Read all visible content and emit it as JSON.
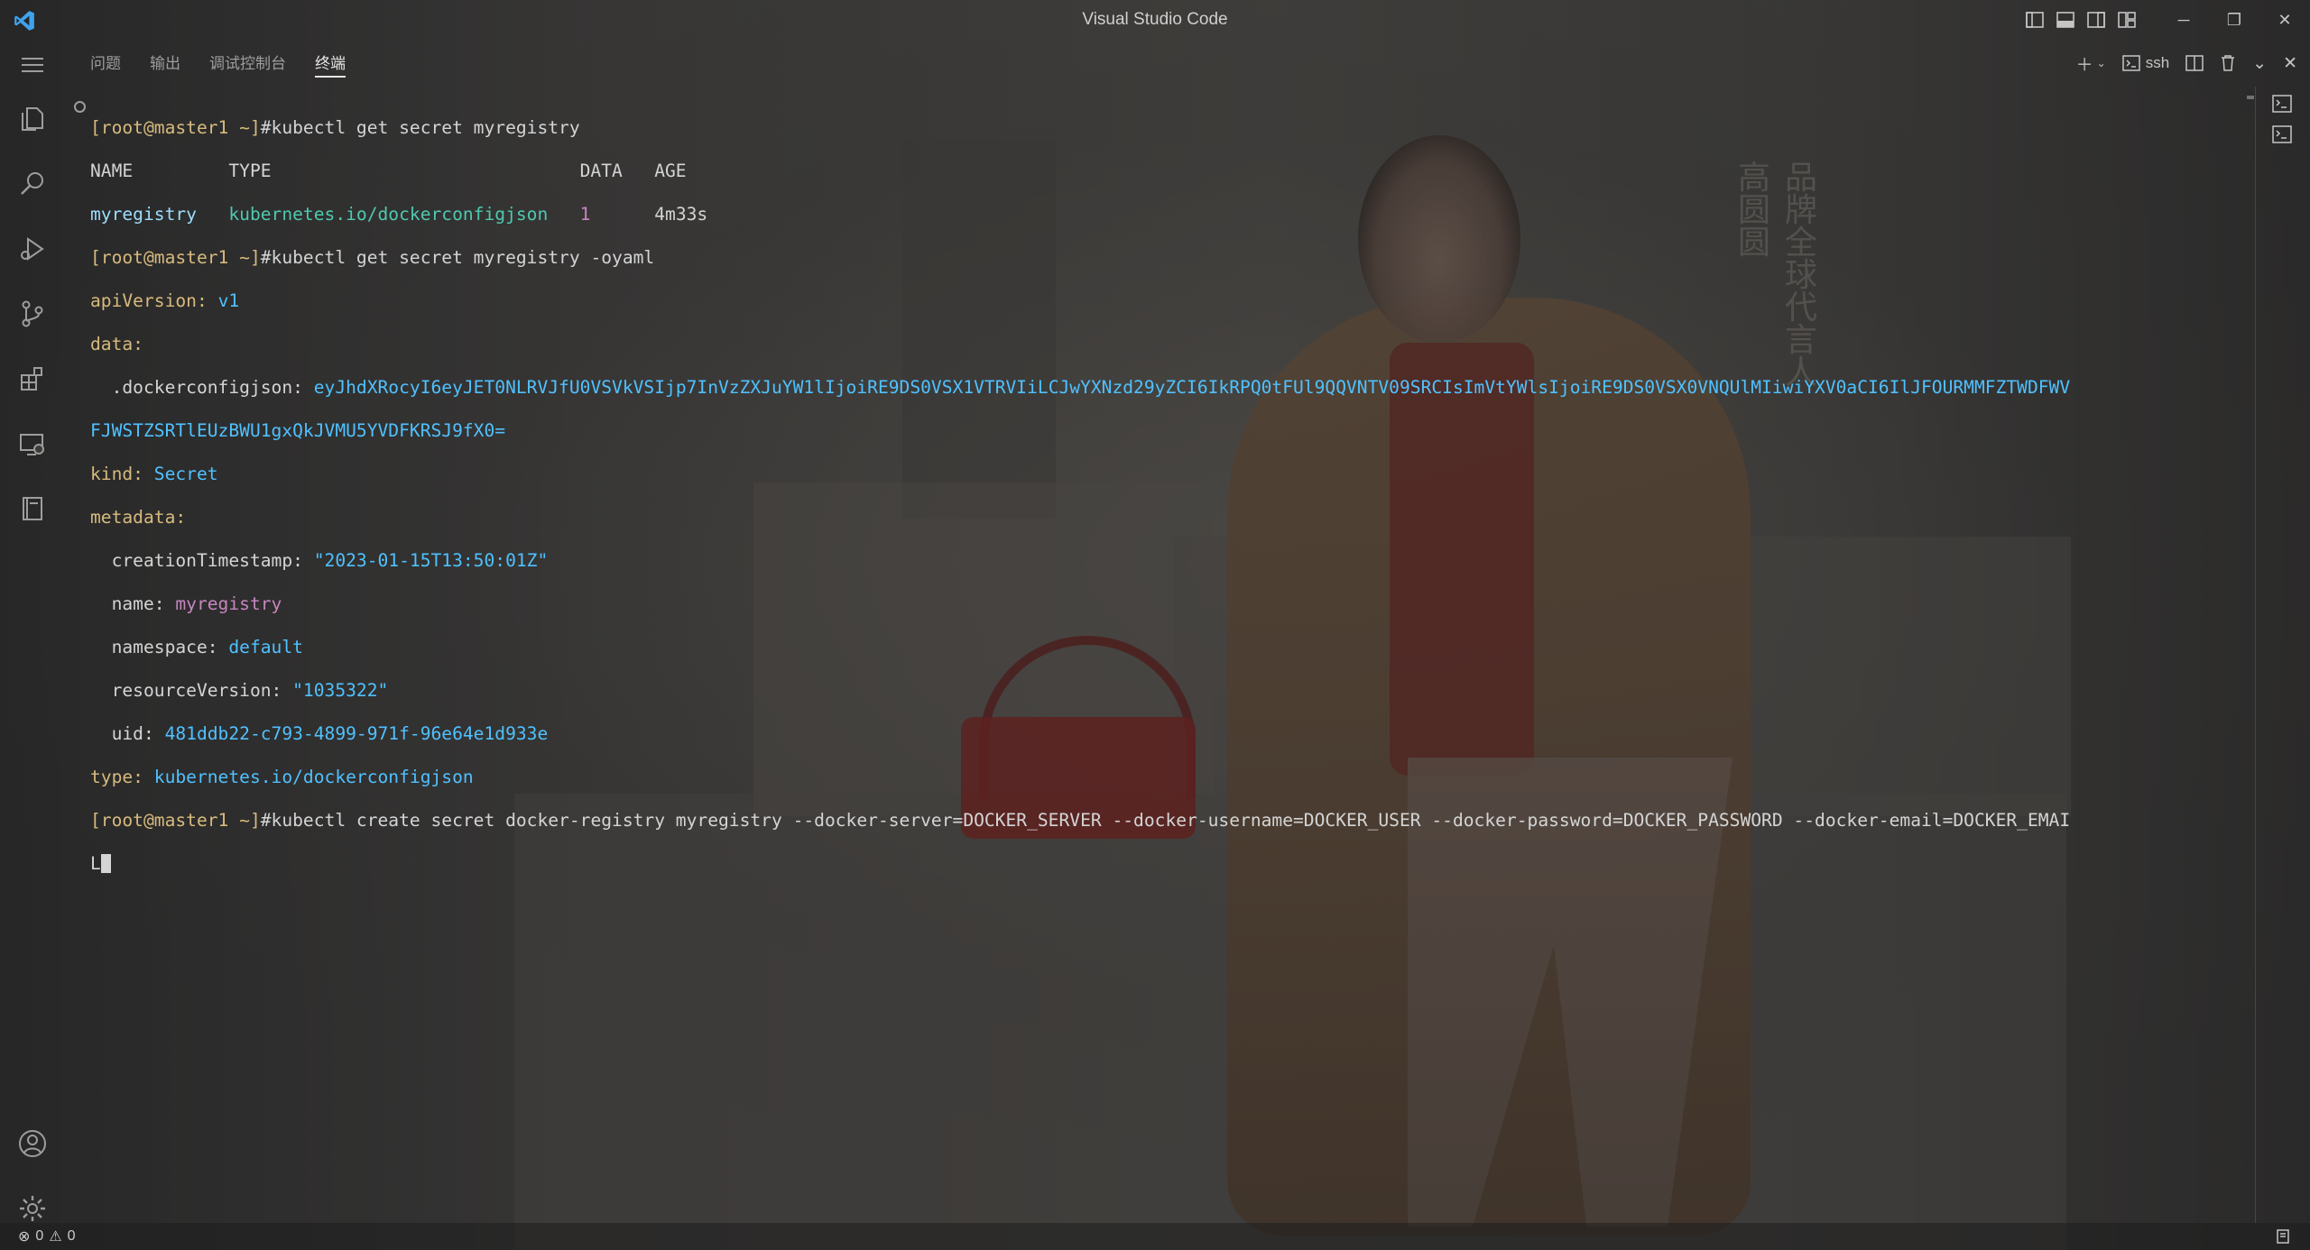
{
  "window": {
    "title": "Visual Studio Code"
  },
  "panel": {
    "tabs": [
      {
        "label": "问题"
      },
      {
        "label": "输出"
      },
      {
        "label": "调试控制台"
      },
      {
        "label": "终端",
        "active": true
      }
    ],
    "terminal_profile_label": "ssh"
  },
  "wallpaper_text": {
    "col1": "品牌全球代言人",
    "col2": "高圆圆"
  },
  "terminal": {
    "lines": [
      {
        "prompt_user": "[root@master1 ~]",
        "prompt_cmd": "#kubectl get secret myregistry"
      },
      {
        "text": "NAME         TYPE                             DATA   AGE"
      },
      {
        "col_name": "myregistry",
        "col_type": "kubernetes.io/dockerconfigjson",
        "col_data": "1",
        "col_age": "4m33s"
      },
      {
        "prompt_user": "[root@master1 ~]",
        "prompt_cmd": "#kubectl get secret myregistry -oyaml"
      },
      {
        "key": "apiVersion:",
        "value": "v1"
      },
      {
        "key": "data:"
      },
      {
        "key": "  .dockerconfigjson:",
        "value": "eyJhdXRocyI6eyJET0NLRVJfU0VSVkVSIjp7InVzZXJuYW1lIjoiRE9DS0VSX1VTRVIiLCJwYXNzd29yZCI6IkRPQ0tFUl9QQVNTV09SRCIsImVtYWlsIjoiRE9DS0VSX0VNQUlMIiwiYXV0aCI6IlJFOURMMFZTWDFWV"
      },
      {
        "value": "FJWSTZSRTlEUzBWU1gxQkJVMU5YVDFKRSJ9fX0="
      },
      {
        "key": "kind:",
        "value": "Secret"
      },
      {
        "key": "metadata:"
      },
      {
        "key": "  creationTimestamp:",
        "value": "\"2023-01-15T13:50:01Z\""
      },
      {
        "key": "  name:",
        "value": "myregistry"
      },
      {
        "key": "  namespace:",
        "value": "default"
      },
      {
        "key": "  resourceVersion:",
        "value": "\"1035322\""
      },
      {
        "key": "  uid:",
        "value": "481ddb22-c793-4899-971f-96e64e1d933e"
      },
      {
        "key": "type:",
        "value": "kubernetes.io/dockerconfigjson"
      },
      {
        "prompt_user": "[root@master1 ~]",
        "prompt_cmd": "#kubectl create secret docker-registry myregistry --docker-server=DOCKER_SERVER --docker-username=DOCKER_USER --docker-password=DOCKER_PASSWORD --docker-email=DOCKER_EMAI"
      },
      {
        "text": "L"
      }
    ]
  },
  "statusbar": {
    "errors": "0",
    "warnings": "0"
  },
  "colors": {
    "prompt": "#d7ba7d",
    "yaml_key": "#9cdcfe",
    "yaml_value": "#4fc1ff"
  }
}
